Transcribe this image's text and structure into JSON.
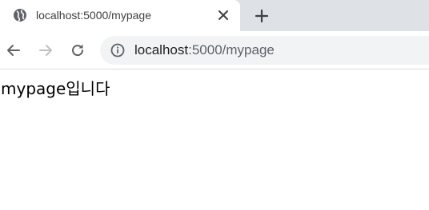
{
  "tab": {
    "title": "localhost:5000/mypage",
    "favicon": "globe-icon",
    "close_icon": "close-icon"
  },
  "tabstrip": {
    "new_tab_icon": "plus-icon"
  },
  "toolbar": {
    "back_icon": "arrow-left-icon",
    "forward_icon": "arrow-right-icon",
    "reload_icon": "reload-icon",
    "site_info_icon": "info-icon"
  },
  "omnibox": {
    "host": "localhost",
    "rest": ":5000/mypage"
  },
  "page": {
    "text": "mypage입니다"
  },
  "colors": {
    "tabstrip_bg": "#dee1e6",
    "omnibox_bg": "#f1f3f4",
    "icon": "#5f6368",
    "icon_disabled": "#bdc1c6"
  }
}
